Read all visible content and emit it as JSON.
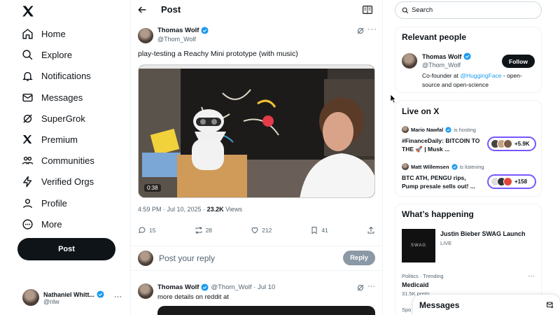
{
  "nav": {
    "items": [
      {
        "label": "Home",
        "icon": "home-icon"
      },
      {
        "label": "Explore",
        "icon": "search-icon"
      },
      {
        "label": "Notifications",
        "icon": "bell-icon"
      },
      {
        "label": "Messages",
        "icon": "mail-icon"
      },
      {
        "label": "SuperGrok",
        "icon": "grok-icon"
      },
      {
        "label": "Premium",
        "icon": "x-icon"
      },
      {
        "label": "Communities",
        "icon": "people-icon"
      },
      {
        "label": "Verified Orgs",
        "icon": "bolt-icon"
      },
      {
        "label": "Profile",
        "icon": "person-icon"
      },
      {
        "label": "More",
        "icon": "more-circle-icon"
      }
    ],
    "post_label": "Post",
    "account": {
      "name": "Nathaniel Whitt...",
      "handle": "@nlw"
    }
  },
  "header": {
    "title": "Post"
  },
  "tweet": {
    "author": "Thomas Wolf",
    "handle": "@Thom_Wolf",
    "text": "play-testing a Reachy Mini prototype (with music)",
    "video_duration": "0:38",
    "timestamp": "4:59 PM · Jul 10, 2025 · ",
    "views": "23.2K",
    "views_label": " Views",
    "actions": {
      "replies": "15",
      "reposts": "28",
      "likes": "212",
      "bookmarks": "41"
    }
  },
  "reply_box": {
    "placeholder": "Post your reply",
    "button": "Reply"
  },
  "thread_reply": {
    "author": "Thomas Wolf",
    "meta": "@Thom_Wolf · Jul 10",
    "text": "more details on reddit at"
  },
  "search": {
    "placeholder": "Search"
  },
  "relevant": {
    "title": "Relevant people",
    "name": "Thomas Wolf",
    "handle": "@Thom_Wolf",
    "follow": "Follow",
    "bio_pre": "Co-founder at ",
    "bio_link": "@HuggingFace",
    "bio_post": " - open-source and open-science"
  },
  "live": {
    "title": "Live on X",
    "items": [
      {
        "host": "Mario Nawfal",
        "status": "is hosting",
        "title": "#FinanceDaily: BITCOIN TO THE 🚀 | Musk ...",
        "count": "+5.9K"
      },
      {
        "host": "Matt Willemsen",
        "status": "is listening",
        "title": "BTC ATH, PENGU rips, Pump presale sells out! ...",
        "count": "+158"
      }
    ]
  },
  "happening": {
    "title": "What’s happening",
    "event_title": "Justin Bieber SWAG Launch",
    "event_status": "LIVE",
    "event_img_text": "SWAG",
    "trend_category": "Politics · Trending",
    "trend_name": "Medicaid",
    "trend_count": "31.5K posts",
    "next_category": "Spo"
  },
  "messages_drawer": {
    "title": "Messages"
  },
  "colors": {
    "accent": "#1d9bf0",
    "text": "#0f1419",
    "muted": "#536471",
    "live": "#7856ff"
  }
}
